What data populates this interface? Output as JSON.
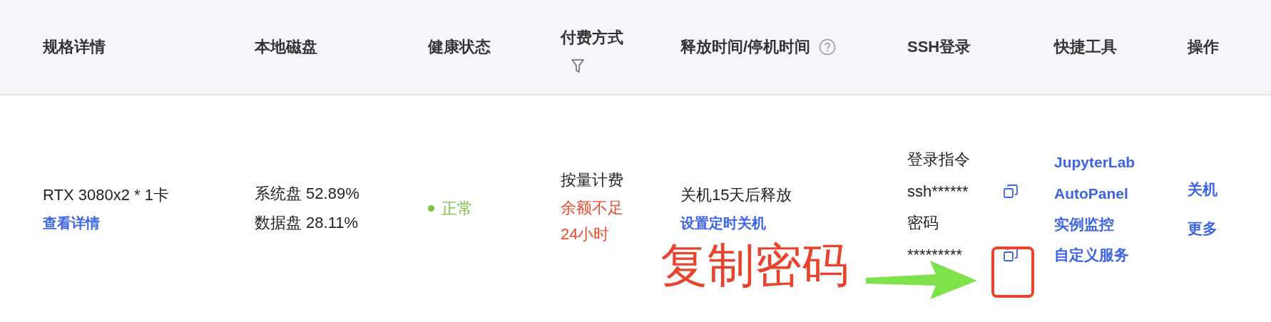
{
  "table": {
    "columns": [
      {
        "label": "规格详情",
        "kind": "plain"
      },
      {
        "label": "本地磁盘",
        "kind": "plain"
      },
      {
        "label": "健康状态",
        "kind": "plain"
      },
      {
        "label": "付费方式",
        "kind": "filter"
      },
      {
        "label": "释放时间/停机时间",
        "kind": "help"
      },
      {
        "label": "SSH登录",
        "kind": "plain"
      },
      {
        "label": "快捷工具",
        "kind": "plain"
      },
      {
        "label": "操作",
        "kind": "plain"
      }
    ],
    "rows": [
      {
        "spec": {
          "name": "RTX 3080x2 * 1卡",
          "link": "查看详情"
        },
        "disk": [
          "系统盘 52.89%",
          "数据盘 28.11%"
        ],
        "health": {
          "label": "正常",
          "color": "#7cc242"
        },
        "billing": {
          "mode": "按量计费",
          "warning": "余额不足24小时"
        },
        "release": {
          "text": "关机15天后释放",
          "link": "设置定时关机"
        },
        "ssh": [
          {
            "label": "登录指令",
            "value": "ssh******"
          },
          {
            "label": "密码",
            "value": "*********"
          }
        ],
        "tools": [
          "JupyterLab",
          "AutoPanel",
          "实例监控",
          "自定义服务"
        ],
        "actions": [
          "关机",
          "更多"
        ]
      }
    ]
  },
  "annotation": {
    "text": "复制密码"
  }
}
